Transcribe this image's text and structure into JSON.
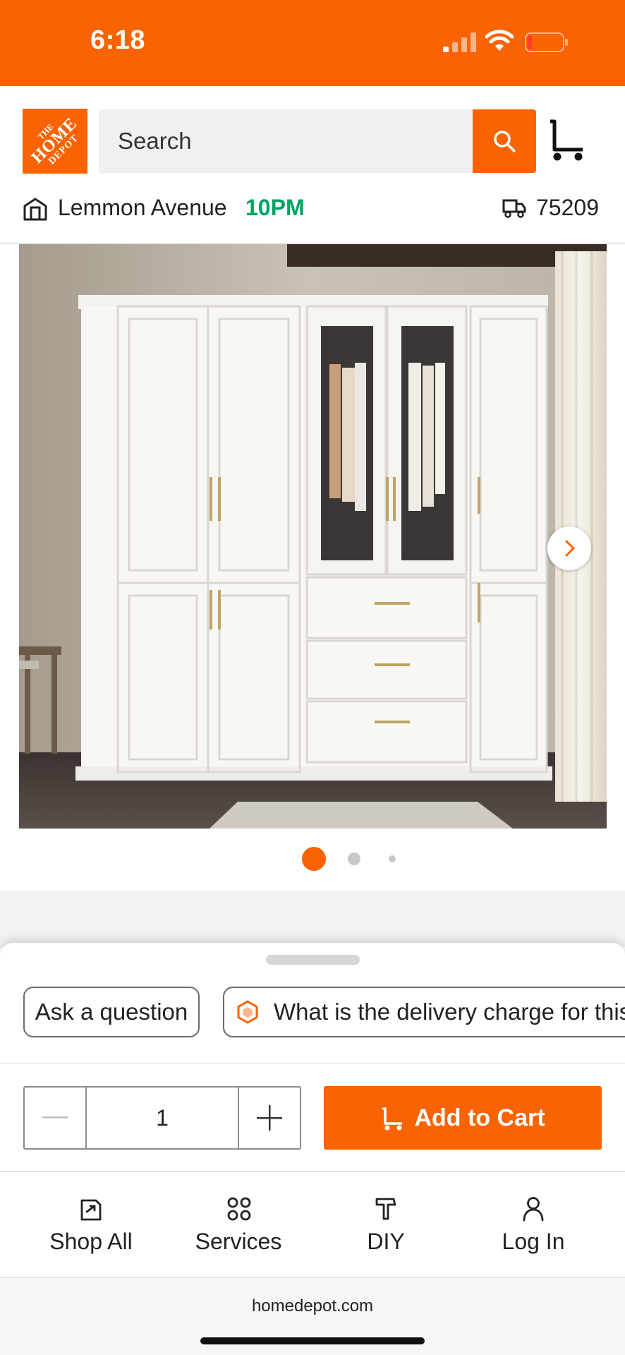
{
  "status_bar": {
    "time": "6:18"
  },
  "header": {
    "logo_text": [
      "THE",
      "HOME",
      "DEPOT"
    ],
    "search_placeholder": "Search",
    "store_name": "Lemmon Avenue",
    "store_hours": "10PM",
    "zip_code": "75209"
  },
  "gallery": {
    "image_alt": "White wardrobe with glass doors and drawers",
    "dot_count": 3,
    "active_dot": 1
  },
  "chat_sheet": {
    "ask_label": "Ask a question",
    "suggested_question": "What is the delivery charge for this item?"
  },
  "purchase": {
    "quantity": "1",
    "add_to_cart_label": "Add to Cart"
  },
  "bottom_nav": {
    "items": [
      {
        "label": "Shop All",
        "icon": "shop-all-icon"
      },
      {
        "label": "Services",
        "icon": "services-icon"
      },
      {
        "label": "DIY",
        "icon": "diy-hammer-icon"
      },
      {
        "label": "Log In",
        "icon": "user-icon"
      }
    ]
  },
  "browser": {
    "url": "homedepot.com"
  },
  "colors": {
    "brand_orange": "#f96302",
    "store_hours_green": "#00a35f"
  }
}
